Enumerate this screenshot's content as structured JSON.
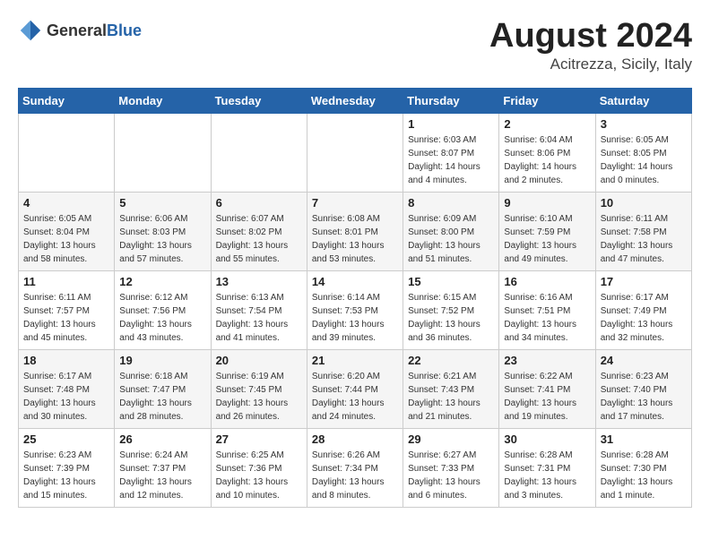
{
  "header": {
    "logo_general": "General",
    "logo_blue": "Blue",
    "month": "August 2024",
    "location": "Acitrezza, Sicily, Italy"
  },
  "weekdays": [
    "Sunday",
    "Monday",
    "Tuesday",
    "Wednesday",
    "Thursday",
    "Friday",
    "Saturday"
  ],
  "weeks": [
    [
      {
        "day": "",
        "info": ""
      },
      {
        "day": "",
        "info": ""
      },
      {
        "day": "",
        "info": ""
      },
      {
        "day": "",
        "info": ""
      },
      {
        "day": "1",
        "info": "Sunrise: 6:03 AM\nSunset: 8:07 PM\nDaylight: 14 hours\nand 4 minutes."
      },
      {
        "day": "2",
        "info": "Sunrise: 6:04 AM\nSunset: 8:06 PM\nDaylight: 14 hours\nand 2 minutes."
      },
      {
        "day": "3",
        "info": "Sunrise: 6:05 AM\nSunset: 8:05 PM\nDaylight: 14 hours\nand 0 minutes."
      }
    ],
    [
      {
        "day": "4",
        "info": "Sunrise: 6:05 AM\nSunset: 8:04 PM\nDaylight: 13 hours\nand 58 minutes."
      },
      {
        "day": "5",
        "info": "Sunrise: 6:06 AM\nSunset: 8:03 PM\nDaylight: 13 hours\nand 57 minutes."
      },
      {
        "day": "6",
        "info": "Sunrise: 6:07 AM\nSunset: 8:02 PM\nDaylight: 13 hours\nand 55 minutes."
      },
      {
        "day": "7",
        "info": "Sunrise: 6:08 AM\nSunset: 8:01 PM\nDaylight: 13 hours\nand 53 minutes."
      },
      {
        "day": "8",
        "info": "Sunrise: 6:09 AM\nSunset: 8:00 PM\nDaylight: 13 hours\nand 51 minutes."
      },
      {
        "day": "9",
        "info": "Sunrise: 6:10 AM\nSunset: 7:59 PM\nDaylight: 13 hours\nand 49 minutes."
      },
      {
        "day": "10",
        "info": "Sunrise: 6:11 AM\nSunset: 7:58 PM\nDaylight: 13 hours\nand 47 minutes."
      }
    ],
    [
      {
        "day": "11",
        "info": "Sunrise: 6:11 AM\nSunset: 7:57 PM\nDaylight: 13 hours\nand 45 minutes."
      },
      {
        "day": "12",
        "info": "Sunrise: 6:12 AM\nSunset: 7:56 PM\nDaylight: 13 hours\nand 43 minutes."
      },
      {
        "day": "13",
        "info": "Sunrise: 6:13 AM\nSunset: 7:54 PM\nDaylight: 13 hours\nand 41 minutes."
      },
      {
        "day": "14",
        "info": "Sunrise: 6:14 AM\nSunset: 7:53 PM\nDaylight: 13 hours\nand 39 minutes."
      },
      {
        "day": "15",
        "info": "Sunrise: 6:15 AM\nSunset: 7:52 PM\nDaylight: 13 hours\nand 36 minutes."
      },
      {
        "day": "16",
        "info": "Sunrise: 6:16 AM\nSunset: 7:51 PM\nDaylight: 13 hours\nand 34 minutes."
      },
      {
        "day": "17",
        "info": "Sunrise: 6:17 AM\nSunset: 7:49 PM\nDaylight: 13 hours\nand 32 minutes."
      }
    ],
    [
      {
        "day": "18",
        "info": "Sunrise: 6:17 AM\nSunset: 7:48 PM\nDaylight: 13 hours\nand 30 minutes."
      },
      {
        "day": "19",
        "info": "Sunrise: 6:18 AM\nSunset: 7:47 PM\nDaylight: 13 hours\nand 28 minutes."
      },
      {
        "day": "20",
        "info": "Sunrise: 6:19 AM\nSunset: 7:45 PM\nDaylight: 13 hours\nand 26 minutes."
      },
      {
        "day": "21",
        "info": "Sunrise: 6:20 AM\nSunset: 7:44 PM\nDaylight: 13 hours\nand 24 minutes."
      },
      {
        "day": "22",
        "info": "Sunrise: 6:21 AM\nSunset: 7:43 PM\nDaylight: 13 hours\nand 21 minutes."
      },
      {
        "day": "23",
        "info": "Sunrise: 6:22 AM\nSunset: 7:41 PM\nDaylight: 13 hours\nand 19 minutes."
      },
      {
        "day": "24",
        "info": "Sunrise: 6:23 AM\nSunset: 7:40 PM\nDaylight: 13 hours\nand 17 minutes."
      }
    ],
    [
      {
        "day": "25",
        "info": "Sunrise: 6:23 AM\nSunset: 7:39 PM\nDaylight: 13 hours\nand 15 minutes."
      },
      {
        "day": "26",
        "info": "Sunrise: 6:24 AM\nSunset: 7:37 PM\nDaylight: 13 hours\nand 12 minutes."
      },
      {
        "day": "27",
        "info": "Sunrise: 6:25 AM\nSunset: 7:36 PM\nDaylight: 13 hours\nand 10 minutes."
      },
      {
        "day": "28",
        "info": "Sunrise: 6:26 AM\nSunset: 7:34 PM\nDaylight: 13 hours\nand 8 minutes."
      },
      {
        "day": "29",
        "info": "Sunrise: 6:27 AM\nSunset: 7:33 PM\nDaylight: 13 hours\nand 6 minutes."
      },
      {
        "day": "30",
        "info": "Sunrise: 6:28 AM\nSunset: 7:31 PM\nDaylight: 13 hours\nand 3 minutes."
      },
      {
        "day": "31",
        "info": "Sunrise: 6:28 AM\nSunset: 7:30 PM\nDaylight: 13 hours\nand 1 minute."
      }
    ]
  ]
}
